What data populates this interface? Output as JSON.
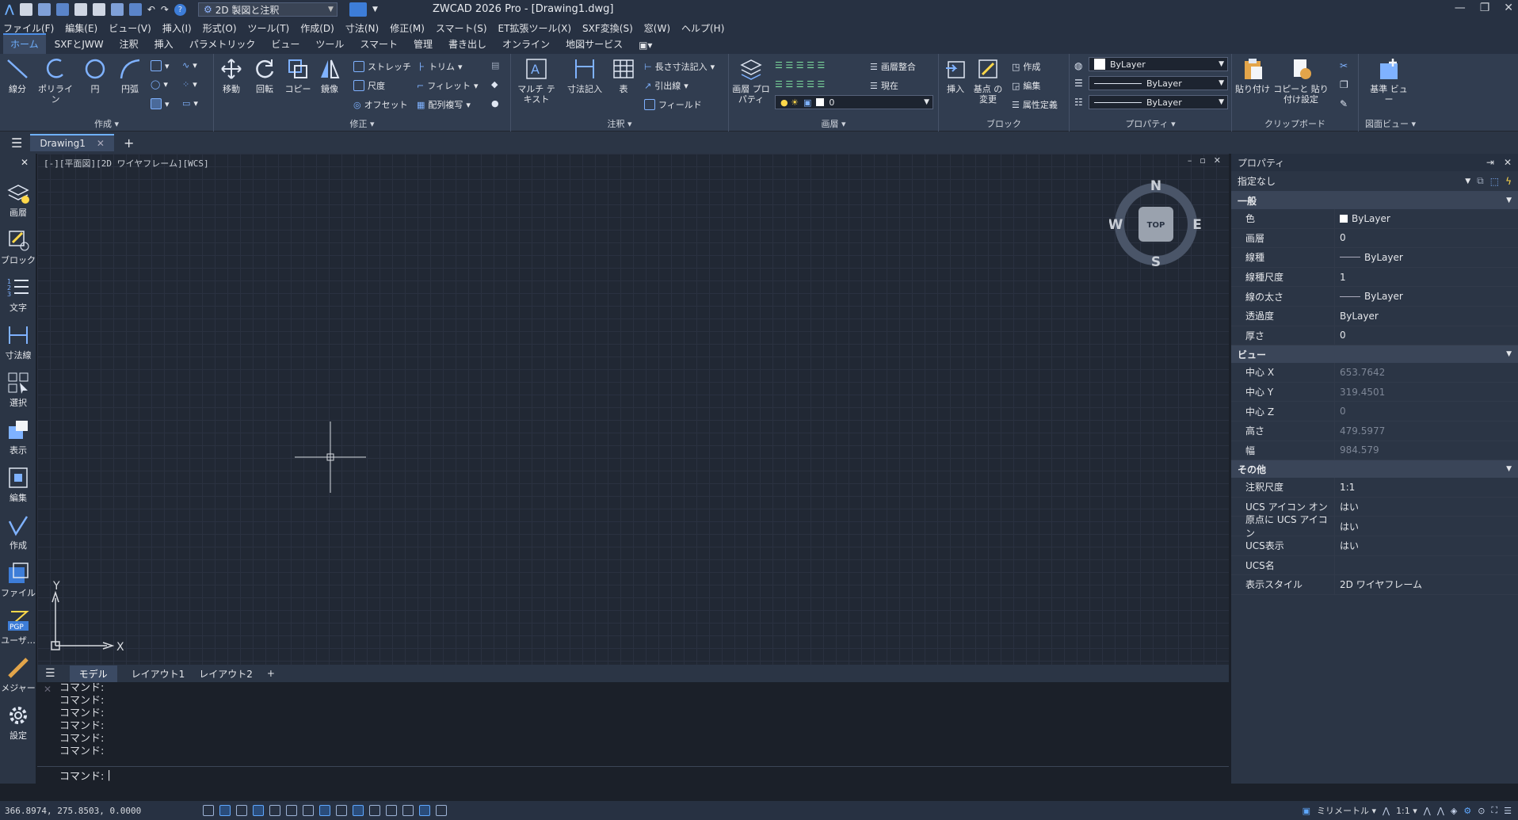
{
  "app": {
    "title": "ZWCAD 2026 Pro - [Drawing1.dwg]",
    "workspace": "2D 製図と注釈"
  },
  "menu": [
    "ファイル(F)",
    "編集(E)",
    "ビュー(V)",
    "挿入(I)",
    "形式(O)",
    "ツール(T)",
    "作成(D)",
    "寸法(N)",
    "修正(M)",
    "スマート(S)",
    "ET拡張ツール(X)",
    "SXF変換(S)",
    "窓(W)",
    "ヘルプ(H)"
  ],
  "ribbon_tabs": [
    "ホーム",
    "SXFとJWW",
    "注釈",
    "挿入",
    "パラメトリック",
    "ビュー",
    "ツール",
    "スマート",
    "管理",
    "書き出し",
    "オンライン",
    "地図サービス"
  ],
  "ribbon": {
    "create": {
      "label": "作成",
      "line": "線分",
      "polyline": "ポリライン",
      "circle": "円",
      "arc": "円弧"
    },
    "modify": {
      "label": "修正",
      "move": "移動",
      "rotate": "回転",
      "copy": "コピー",
      "mirror": "鏡像",
      "stretch": "ストレッチ",
      "scale": "尺度",
      "offset": "オフセット",
      "trim": "トリム",
      "fillet": "フィレット",
      "array": "配列複写"
    },
    "annotation": {
      "label": "注釈",
      "mtext": "マルチ テキスト",
      "dimension": "寸法記入",
      "table": "表",
      "linear": "長さ寸法記入",
      "leader": "引出線",
      "field": "フィールド"
    },
    "layers": {
      "label": "画層",
      "props": "画層 プロパティ",
      "match": "画層整合",
      "current": "現在",
      "layer_value": "0"
    },
    "block": {
      "label": "ブロック",
      "insert": "挿入",
      "base": "基点 の変更",
      "create": "作成",
      "edit": "編集",
      "attr": "属性定義"
    },
    "properties": {
      "label": "プロパティ",
      "color": "ByLayer",
      "linetype": "ByLayer",
      "lineweight": "ByLayer"
    },
    "clipboard": {
      "label": "クリップボード",
      "paste": "貼り付け",
      "paste_special": "コピーと 貼り付け設定"
    },
    "views": {
      "label": "図面ビュー",
      "base": "基準 ビュー"
    }
  },
  "doc_tab": "Drawing1",
  "left_tools": [
    "画層",
    "ブロック",
    "文字",
    "寸法線",
    "選択",
    "表示",
    "編集",
    "作成",
    "ファイル",
    "ユーザ…",
    "メジャー",
    "設定"
  ],
  "viewport": {
    "label": "[-][平面図][2D ワイヤフレーム][WCS]",
    "compass": {
      "n": "N",
      "s": "S",
      "e": "E",
      "w": "W",
      "top": "TOP"
    },
    "ucs": {
      "x": "X",
      "y": "Y"
    }
  },
  "layout_tabs": [
    "モデル",
    "レイアウト1",
    "レイアウト2",
    "+"
  ],
  "command": {
    "history": [
      "コマンド:",
      "コマンド:",
      "コマンド:",
      "コマンド:",
      "コマンド:",
      "コマンド:"
    ],
    "prompt": "コマンド:"
  },
  "properties_panel": {
    "title": "プロパティ",
    "selection": "指定なし",
    "sections": [
      {
        "name": "一般",
        "rows": [
          {
            "k": "色",
            "v": "ByLayer"
          },
          {
            "k": "画層",
            "v": "0"
          },
          {
            "k": "線種",
            "v": "ByLayer"
          },
          {
            "k": "線種尺度",
            "v": "1"
          },
          {
            "k": "線の太さ",
            "v": "ByLayer"
          },
          {
            "k": "透過度",
            "v": "ByLayer"
          },
          {
            "k": "厚さ",
            "v": "0"
          }
        ]
      },
      {
        "name": "ビュー",
        "rows": [
          {
            "k": "中心 X",
            "v": "653.7642"
          },
          {
            "k": "中心 Y",
            "v": "319.4501"
          },
          {
            "k": "中心 Z",
            "v": "0"
          },
          {
            "k": "高さ",
            "v": "479.5977"
          },
          {
            "k": "幅",
            "v": "984.579"
          }
        ]
      },
      {
        "name": "その他",
        "rows": [
          {
            "k": "注釈尺度",
            "v": "1:1"
          },
          {
            "k": "UCS アイコン オン",
            "v": "はい"
          },
          {
            "k": "原点に UCS アイコン",
            "v": "はい"
          },
          {
            "k": "UCS表示",
            "v": "はい"
          },
          {
            "k": "UCS名",
            "v": ""
          },
          {
            "k": "表示スタイル",
            "v": "2D ワイヤフレーム"
          }
        ]
      }
    ]
  },
  "status": {
    "coords": "366.8974, 275.8503, 0.0000",
    "units": "ミリメートル",
    "scale": "1:1"
  }
}
